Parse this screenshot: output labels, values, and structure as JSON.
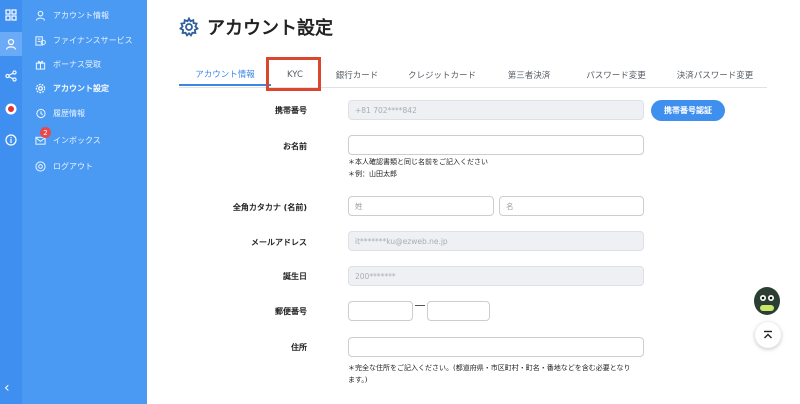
{
  "sidebar": {
    "items": [
      {
        "label": "アカウント情報",
        "icon": "user-icon"
      },
      {
        "label": "ファイナンスサービス",
        "icon": "finance-icon"
      },
      {
        "label": "ボーナス受取",
        "icon": "gift-icon"
      },
      {
        "label": "アカウント設定",
        "icon": "gear-icon"
      },
      {
        "label": "履歴情報",
        "icon": "history-icon"
      },
      {
        "label": "インボックス",
        "icon": "inbox-icon",
        "badge": "2"
      },
      {
        "label": "ログアウト",
        "icon": "logout-icon"
      }
    ]
  },
  "page": {
    "title": "アカウント設定"
  },
  "tabs": [
    {
      "label": "アカウント情報",
      "active": true
    },
    {
      "label": "KYC",
      "active": false
    },
    {
      "label": "銀行カード",
      "active": false
    },
    {
      "label": "クレジットカード",
      "active": false
    },
    {
      "label": "第三者決済",
      "active": false
    },
    {
      "label": "パスワード変更",
      "active": false
    },
    {
      "label": "決済パスワード変更",
      "active": false
    }
  ],
  "form": {
    "phone": {
      "label": "携帯番号",
      "value": "+81 702****842",
      "button": "携帯番号認証"
    },
    "name": {
      "label": "お名前",
      "value": "",
      "note1": "＊本人確認書類と同じ名前をご記入ください",
      "note2": "＊例：山田太郎"
    },
    "kana": {
      "label": "全角カタカナ (名前)",
      "last_placeholder": "姓",
      "first_placeholder": "名"
    },
    "email": {
      "label": "メールアドレス",
      "value": "it*******ku@ezweb.ne.jp"
    },
    "birthday": {
      "label": "誕生日",
      "value": "200*******"
    },
    "postal": {
      "label": "郵便番号",
      "first": "",
      "second": ""
    },
    "address": {
      "label": "住所",
      "value": "",
      "note1": "＊完全な住所をご記入ください。(都道府県・市区町村・町名・番地などを含む必要となり",
      "note2": "ます。)"
    }
  },
  "colors": {
    "sidebar": "#4a9af3",
    "rail": "#3f8ff0",
    "accent": "#3b87e6",
    "highlight": "#d9472d"
  }
}
